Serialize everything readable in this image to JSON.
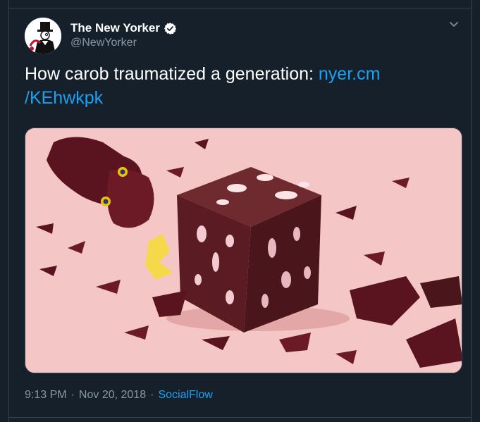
{
  "author": {
    "name": "The New Yorker",
    "handle": "@NewYorker",
    "verified": true,
    "avatar_icon": "top-hat-gentleman-logo"
  },
  "tweet": {
    "text": "How carob traumatized a generation: ",
    "link_text": "nyer.cm\n/KEhwkpk",
    "link_line1": "nyer.cm",
    "link_line2": "/KEhwkpk"
  },
  "media": {
    "description_icon": "illustration-carob-cube-broken-chocolate-bunny"
  },
  "footer": {
    "time": "9:13 PM",
    "separator": "·",
    "date": "Nov 20, 2018",
    "source": "SocialFlow"
  },
  "colors": {
    "background": "#15202b",
    "text": "#ffffff",
    "secondary": "#8899a6",
    "accent": "#1da1f2",
    "border": "#38444d",
    "media_bg": "#f4c6c6"
  }
}
